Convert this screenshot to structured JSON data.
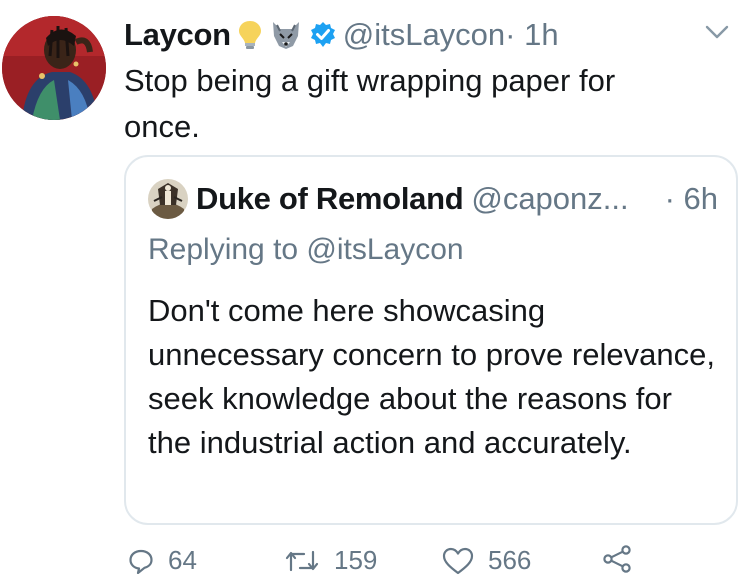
{
  "author": {
    "name": "Laycon",
    "handle": "@itsLaycon",
    "time_sep": " · 1h",
    "emojis": [
      "lightbulb-icon",
      "wolf-icon"
    ],
    "verified": true
  },
  "tweet": {
    "text": "Stop being a gift wrapping paper for once."
  },
  "quoted": {
    "name": "Duke of Remoland",
    "handle": "@caponz...",
    "time": "· 6h",
    "replying_to": "Replying to @itsLaycon",
    "text": "Don't come here showcasing unnecessary concern to prove relevance, seek knowledge about the reasons for the industrial action and accurately."
  },
  "actions": {
    "replies": "64",
    "retweets": "159",
    "likes": "566"
  },
  "colors": {
    "text": "#14171a",
    "secondary": "#657786",
    "verified": "#1da1f2",
    "border": "#e1e8ed"
  }
}
